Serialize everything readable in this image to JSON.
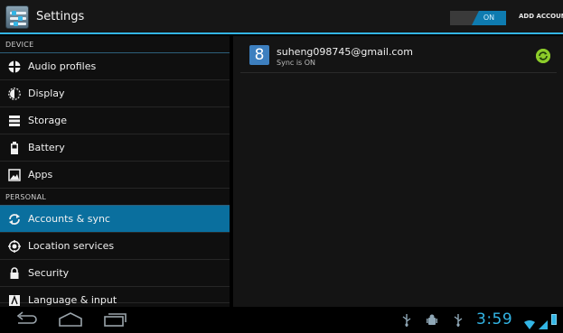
{
  "actionbar": {
    "title": "Settings",
    "app_icon": "settings-icon",
    "toggle_label": "ON",
    "add_account_label": "ADD ACCOUNT"
  },
  "sidebar": {
    "section_device": "DEVICE",
    "device_items": [
      {
        "label": "Audio profiles",
        "icon": "audio-profiles-icon"
      },
      {
        "label": "Display",
        "icon": "display-icon"
      },
      {
        "label": "Storage",
        "icon": "storage-icon"
      },
      {
        "label": "Battery",
        "icon": "battery-icon"
      },
      {
        "label": "Apps",
        "icon": "apps-icon"
      }
    ],
    "section_personal": "PERSONAL",
    "personal_items": [
      {
        "label": "Accounts & sync",
        "icon": "sync-icon",
        "selected": true
      },
      {
        "label": "Location services",
        "icon": "location-icon"
      },
      {
        "label": "Security",
        "icon": "lock-icon"
      },
      {
        "label": "Language & input",
        "icon": "language-icon"
      }
    ]
  },
  "accounts": [
    {
      "email": "suheng098745@gmail.com",
      "status": "Sync is ON",
      "icon_glyph": "8"
    }
  ],
  "statusbar": {
    "time": "3:59"
  },
  "colors": {
    "accent": "#33b5e5",
    "selected": "#0a6f9e",
    "sync_ok": "#8ccc2a"
  }
}
